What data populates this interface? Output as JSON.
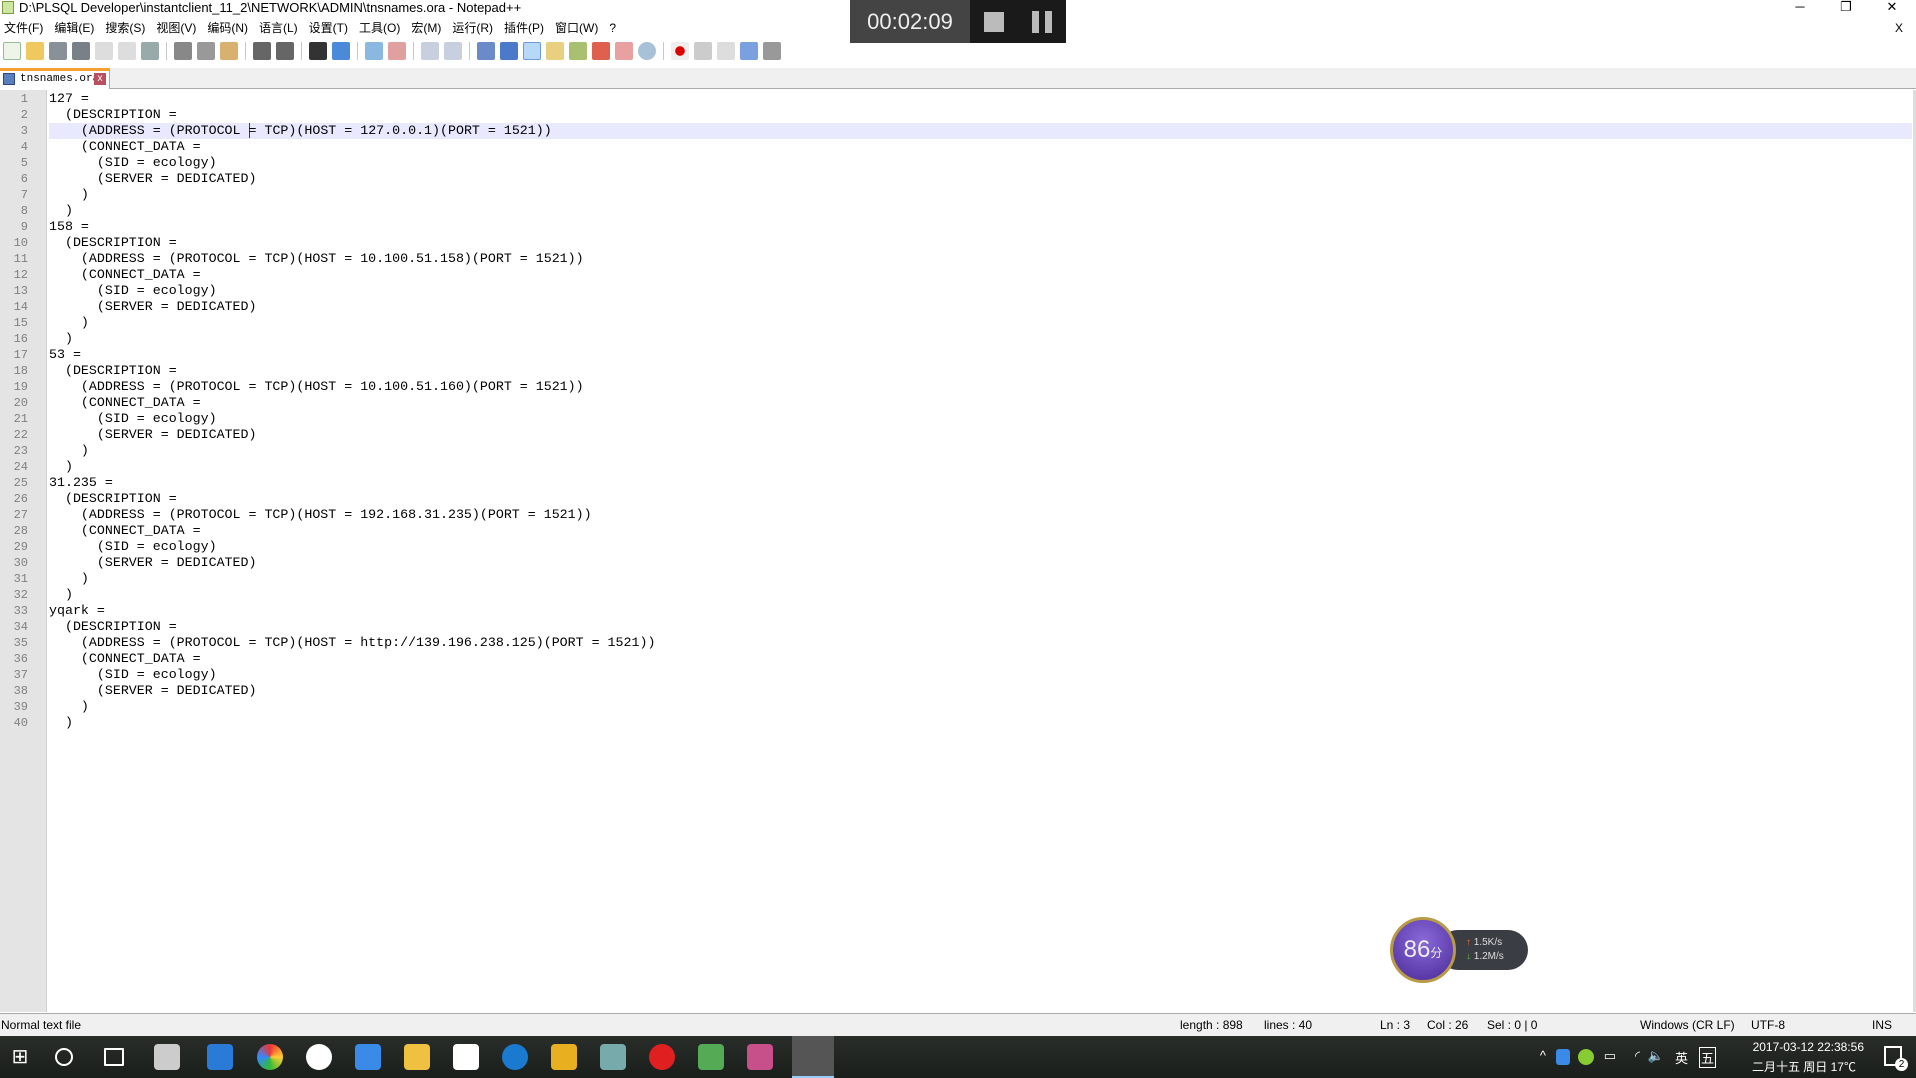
{
  "window": {
    "title": "D:\\PLSQL Developer\\instantclient_11_2\\NETWORK\\ADMIN\\tnsnames.ora - Notepad++",
    "minimize": "─",
    "restore": "❐",
    "close": "✕",
    "close_doc": "X"
  },
  "menu": [
    "文件(F)",
    "编辑(E)",
    "搜索(S)",
    "视图(V)",
    "编码(N)",
    "语言(L)",
    "设置(T)",
    "工具(O)",
    "宏(M)",
    "运行(R)",
    "插件(P)",
    "窗口(W)",
    "?"
  ],
  "recorder": {
    "time": "00:02:09"
  },
  "tab": {
    "label": "tnsnames.ora",
    "close": "x"
  },
  "editor": {
    "current_line": 3,
    "caret_col": 26,
    "lines": [
      "127 =",
      "  (DESCRIPTION =",
      "    (ADDRESS = (PROTOCOL = TCP)(HOST = 127.0.0.1)(PORT = 1521))",
      "    (CONNECT_DATA =",
      "      (SID = ecology)",
      "      (SERVER = DEDICATED)",
      "    )",
      "  )",
      "158 =",
      "  (DESCRIPTION =",
      "    (ADDRESS = (PROTOCOL = TCP)(HOST = 10.100.51.158)(PORT = 1521))",
      "    (CONNECT_DATA =",
      "      (SID = ecology)",
      "      (SERVER = DEDICATED)",
      "    )",
      "  )",
      "53 =",
      "  (DESCRIPTION =",
      "    (ADDRESS = (PROTOCOL = TCP)(HOST = 10.100.51.160)(PORT = 1521))",
      "    (CONNECT_DATA =",
      "      (SID = ecology)",
      "      (SERVER = DEDICATED)",
      "    )",
      "  )",
      "31.235 =",
      "  (DESCRIPTION =",
      "    (ADDRESS = (PROTOCOL = TCP)(HOST = 192.168.31.235)(PORT = 1521))",
      "    (CONNECT_DATA =",
      "      (SID = ecology)",
      "      (SERVER = DEDICATED)",
      "    )",
      "  )",
      "yqark =",
      "  (DESCRIPTION =",
      "    (ADDRESS = (PROTOCOL = TCP)(HOST = http://139.196.238.125)(PORT = 1521))",
      "    (CONNECT_DATA =",
      "      (SID = ecology)",
      "      (SERVER = DEDICATED)",
      "    )",
      "  )"
    ]
  },
  "status": {
    "type": "Normal text file",
    "length": "length : 898",
    "lines": "lines : 40",
    "ln": "Ln : 3",
    "col": "Col : 26",
    "sel": "Sel : 0 | 0",
    "eol": "Windows (CR LF)",
    "encoding": "UTF-8",
    "mode": "INS"
  },
  "widget": {
    "score": "86",
    "unit": "分",
    "up": "1.5K/s",
    "down": "1.2M/s"
  },
  "tray": {
    "lang": "英",
    "ime": "五",
    "datetime": "2017-03-12  22:38:56",
    "date_lunar": "二月十五 周日 17℃",
    "notifications": "2"
  },
  "colors": {
    "accent_tab": "#f6a032",
    "current_line": "#e8e8ff",
    "caret": "#8000ff"
  }
}
